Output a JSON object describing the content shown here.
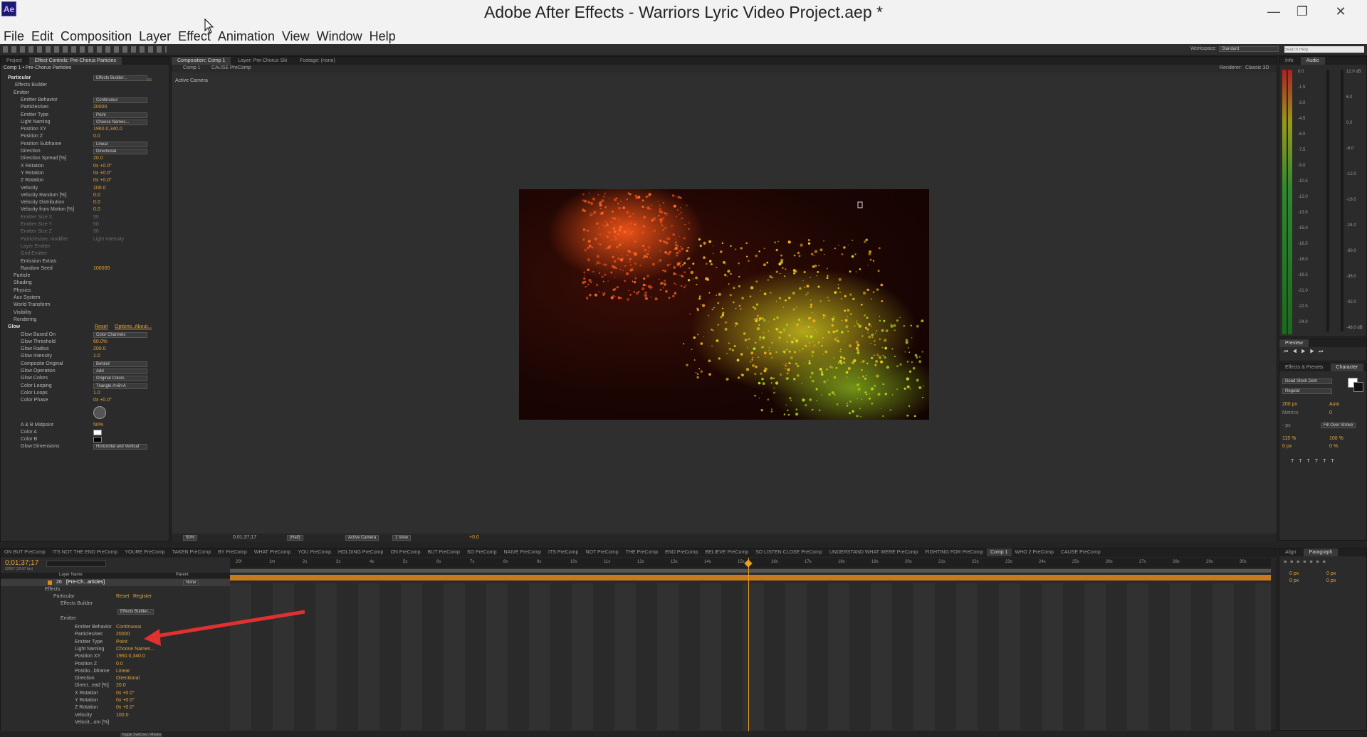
{
  "window": {
    "app_icon": "Ae",
    "title": "Adobe After Effects - Warriors Lyric Video Project.aep *",
    "minimize": "—",
    "maximize": "❐",
    "close": "✕"
  },
  "menu": [
    "File",
    "Edit",
    "Composition",
    "Layer",
    "Effect",
    "Animation",
    "View",
    "Window",
    "Help"
  ],
  "toolbar": {
    "workspace_label": "Workspace:",
    "workspace_value": "Standard",
    "search_placeholder": "Search Help"
  },
  "effect_controls": {
    "tabs": [
      "Project",
      "Effect Controls: Pre-Chorus Particles"
    ],
    "header": "Comp 1 • Pre-Chorus Particles",
    "particular": {
      "name": "Particular",
      "links": [
        "Reset",
        "Register",
        "About..."
      ],
      "effects_builder_label": "Effects Builder",
      "effects_builder_button": "Effects Builder...",
      "emitter": "Emitter",
      "rows": [
        {
          "label": "Emitter Behavior",
          "value": "Continuous",
          "kind": "dropdown"
        },
        {
          "label": "Particles/sec",
          "value": "20000",
          "kind": "value"
        },
        {
          "label": "Emitter Type",
          "value": "Point",
          "kind": "dropdown"
        },
        {
          "label": "Light Naming",
          "value": "Choose Names...",
          "kind": "button"
        },
        {
          "label": "Position XY",
          "value": "1960.0,340.0",
          "kind": "value"
        },
        {
          "label": "Position Z",
          "value": "0.0",
          "kind": "value"
        },
        {
          "label": "Position Subframe",
          "value": "Linear",
          "kind": "dropdown"
        },
        {
          "label": "Direction",
          "value": "Directional",
          "kind": "dropdown"
        },
        {
          "label": "Direction Spread [%]",
          "value": "20.0",
          "kind": "value"
        },
        {
          "label": "X Rotation",
          "value": "0x +0.0°",
          "kind": "value"
        },
        {
          "label": "Y Rotation",
          "value": "0x +0.0°",
          "kind": "value"
        },
        {
          "label": "Z Rotation",
          "value": "0x +0.0°",
          "kind": "value"
        },
        {
          "label": "Velocity",
          "value": "100.0",
          "kind": "value"
        },
        {
          "label": "Velocity Random [%]",
          "value": "0.0",
          "kind": "value"
        },
        {
          "label": "Velocity Distribution",
          "value": "0.0",
          "kind": "value"
        },
        {
          "label": "Velocity from Motion [%]",
          "value": "0.0",
          "kind": "value"
        },
        {
          "label": "Emitter Size X",
          "value": "50",
          "kind": "grey"
        },
        {
          "label": "Emitter Size Y",
          "value": "50",
          "kind": "grey"
        },
        {
          "label": "Emitter Size Z",
          "value": "50",
          "kind": "grey"
        },
        {
          "label": "Particles/sec modifier",
          "value": "Light Intensity",
          "kind": "grey"
        },
        {
          "label": "Layer Emitter",
          "value": "",
          "kind": "grey"
        },
        {
          "label": "Grid Emitter",
          "value": "",
          "kind": "grey"
        },
        {
          "label": "Emission Extras",
          "value": "",
          "kind": "plain"
        },
        {
          "label": "Random Seed",
          "value": "100000",
          "kind": "value"
        }
      ],
      "groups": [
        "Particle",
        "Shading",
        "Physics",
        "Aux System",
        "World Transform",
        "Visibility",
        "Rendering"
      ]
    },
    "glow": {
      "name": "Glow",
      "links": [
        "Reset",
        "Options...",
        "About..."
      ],
      "rows": [
        {
          "label": "Glow Based On",
          "value": "Color Channels",
          "kind": "dropdown"
        },
        {
          "label": "Glow Threshold",
          "value": "60.0%",
          "kind": "value"
        },
        {
          "label": "Glow Radius",
          "value": "200.0",
          "kind": "value"
        },
        {
          "label": "Glow Intensity",
          "value": "1.0",
          "kind": "value"
        },
        {
          "label": "Composite Original",
          "value": "Behind",
          "kind": "dropdown"
        },
        {
          "label": "Glow Operation",
          "value": "Add",
          "kind": "dropdown"
        },
        {
          "label": "Glow Colors",
          "value": "Original Colors",
          "kind": "dropdown"
        },
        {
          "label": "Color Looping",
          "value": "Triangle A>B>A",
          "kind": "dropdown"
        },
        {
          "label": "Color Loops",
          "value": "1.0",
          "kind": "value"
        },
        {
          "label": "Color Phase",
          "value": "0x +0.0°",
          "kind": "value"
        }
      ],
      "rows2": [
        {
          "label": "A & B Midpoint",
          "value": "50%",
          "kind": "value"
        },
        {
          "label": "Color A",
          "value": "",
          "kind": "swatch-white"
        },
        {
          "label": "Color B",
          "value": "",
          "kind": "swatch-black"
        },
        {
          "label": "Glow Dimensions",
          "value": "Horizontal and Vertical",
          "kind": "dropdown"
        }
      ]
    }
  },
  "composition": {
    "tabs": [
      "Composition: Comp 1",
      "Layer: Pre-Chorus Ski",
      "Footage: (none)"
    ],
    "breadcrumbs": [
      "Comp 1",
      "CAUSE PreComp"
    ],
    "renderer_label": "Renderer:",
    "renderer_value": "Classic 3D",
    "camera_label": "Active Camera",
    "footer": {
      "zoom": "50%",
      "timecode": "0;01;37;17",
      "resolution": "(Half)",
      "camera": "Active Camera",
      "view": "1 View",
      "exposure": "+0.0"
    }
  },
  "info_panel": {
    "tabs": [
      "Info",
      "Audio"
    ],
    "left_scale": [
      "0.0",
      "-1.5",
      "-3.0",
      "-4.5",
      "-6.0",
      "-7.5",
      "-9.0",
      "-10.5",
      "-12.0",
      "-13.5",
      "-15.0",
      "-16.5",
      "-18.0",
      "-19.5",
      "-21.0",
      "-22.5",
      "-24.0"
    ],
    "right_scale": [
      "12.0 dB",
      "6.0",
      "0.0",
      "-6.0",
      "-12.0",
      "-18.0",
      "-24.0",
      "-30.0",
      "-36.0",
      "-42.0",
      "-48.0 dB"
    ]
  },
  "preview_panel": {
    "title": "Preview"
  },
  "character_panel": {
    "tabs": [
      "Effects & Presets",
      "Character"
    ],
    "font": "Dead Stock Dem",
    "style": "Regular",
    "size": "200 px",
    "leading": "Auto",
    "kerning": "Metrics",
    "tracking": "0",
    "stroke": "Fill Over Stroke",
    "vscale": "115 %",
    "hscale": "100 %",
    "baseline": "0 px",
    "tsume": "0 %",
    "stroke_width": "- px"
  },
  "paragraph_panel": {
    "tabs": [
      "Align",
      "Paragraph"
    ],
    "indent_left": "0 px",
    "indent_right": "0 px",
    "space_before": "0 px",
    "space_after": "0 px"
  },
  "timeline": {
    "tabs": [
      "ON BUT PreComp",
      "ITS NOT THE END PreComp",
      "YOURE PreComp",
      "TAKEN PreComp",
      "BY PreComp",
      "WHAT PreComp",
      "YOU PreComp",
      "HOLDING PreComp",
      "ON PreComp",
      "BUT PreComp",
      "SO PreComp",
      "NAIVE PreComp",
      "ITS PreComp",
      "NOT PreComp",
      "THE PreComp",
      "END PreComp",
      "BELIEVE PreComp",
      "SO LISTEN CLOSE PreComp",
      "UNDERSTAND WHAT WERE PreComp",
      "FIGHTING FOR PreComp",
      "Comp 1",
      "WHO 2 PreComp",
      "CAUSE PreComp"
    ],
    "active_tab": "Comp 1",
    "timecode": "0;01;37;17",
    "fps": "02957 (29.97 fps)",
    "layer_name_header": "Layer Name",
    "parent_header": "Parent",
    "layer": {
      "number": "26",
      "name": "[Pre-Ch...articles]",
      "parent": "None"
    },
    "effects_label": "Effects",
    "particular_label": "Particular",
    "reset_label": "Reset",
    "register_label": "Register",
    "effects_builder_label": "Effects Builder",
    "effects_builder_button": "Effects Builder...",
    "emitter_label": "Emitter",
    "rows": [
      {
        "label": "Emitter Behavior",
        "value": "Continuous"
      },
      {
        "label": "Particles/sec",
        "value": "20000"
      },
      {
        "label": "Emitter Type",
        "value": "Point"
      },
      {
        "label": "Light Naming",
        "value": "Choose Names..."
      },
      {
        "label": "Position XY",
        "value": "1960.0,340.0"
      },
      {
        "label": "Position Z",
        "value": "0.0"
      },
      {
        "label": "Positio...bframe",
        "value": "Linear"
      },
      {
        "label": "Direction",
        "value": "Directional"
      },
      {
        "label": "Direct...ead [%]",
        "value": "20.0"
      },
      {
        "label": "X Rotation",
        "value": "0x +0.0°"
      },
      {
        "label": "Y Rotation",
        "value": "0x +0.0°"
      },
      {
        "label": "Z Rotation",
        "value": "0x +0.0°"
      },
      {
        "label": "Velocity",
        "value": "100.0"
      },
      {
        "label": "Velocit...om [%]",
        "value": ""
      }
    ],
    "ruler": [
      "20f",
      "1m",
      "2s",
      "3s",
      "4s",
      "5s",
      "6s",
      "7s",
      "8s",
      "9s",
      "10s",
      "11s",
      "12s",
      "13s",
      "14s",
      "15s",
      "16s",
      "17s",
      "18s",
      "19s",
      "20s",
      "21s",
      "22s",
      "23s",
      "24s",
      "25s",
      "26s",
      "27s",
      "28s",
      "29s",
      "30s"
    ],
    "footer_label": "Toggle Switches / Modes"
  },
  "colors": {
    "accent_orange": "#e2a33c",
    "timebar_orange": "#c87a1e",
    "playhead": "#e8a020",
    "arrow_red": "#e03030"
  }
}
